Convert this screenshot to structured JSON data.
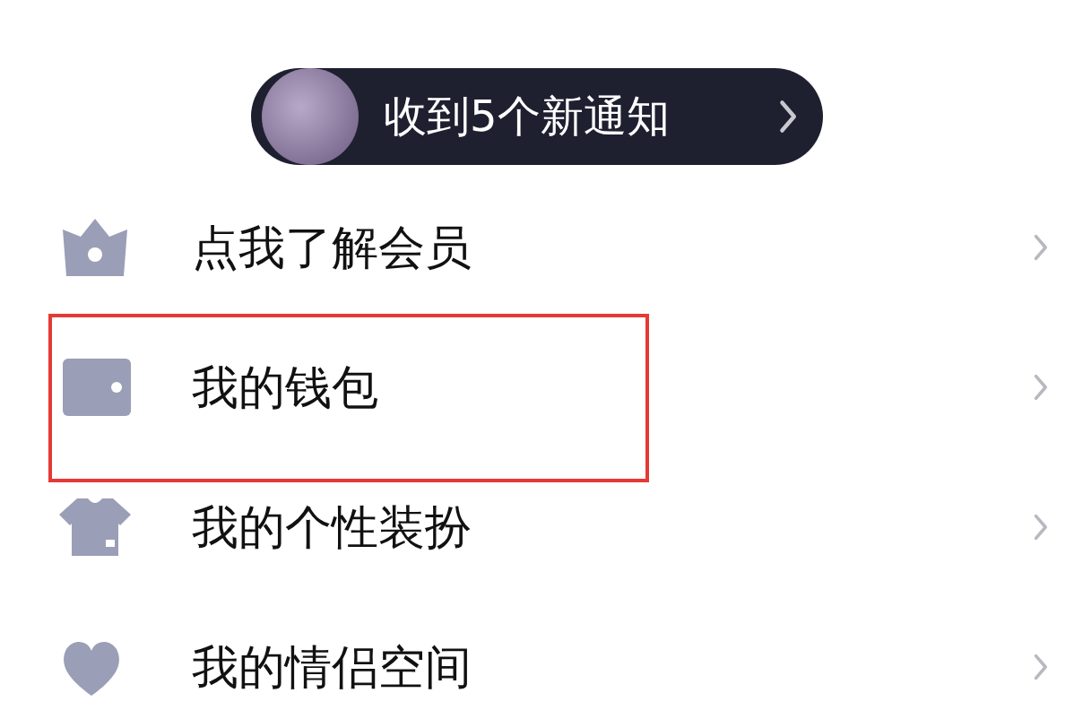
{
  "notification": {
    "text": "收到5个新通知"
  },
  "menu": [
    {
      "kind": "vip",
      "label": "点我了解会员",
      "highlighted": false
    },
    {
      "kind": "wallet",
      "label": "我的钱包",
      "highlighted": true
    },
    {
      "kind": "dress",
      "label": "我的个性装扮",
      "highlighted": false
    },
    {
      "kind": "couple",
      "label": "我的情侣空间",
      "highlighted": false
    }
  ]
}
